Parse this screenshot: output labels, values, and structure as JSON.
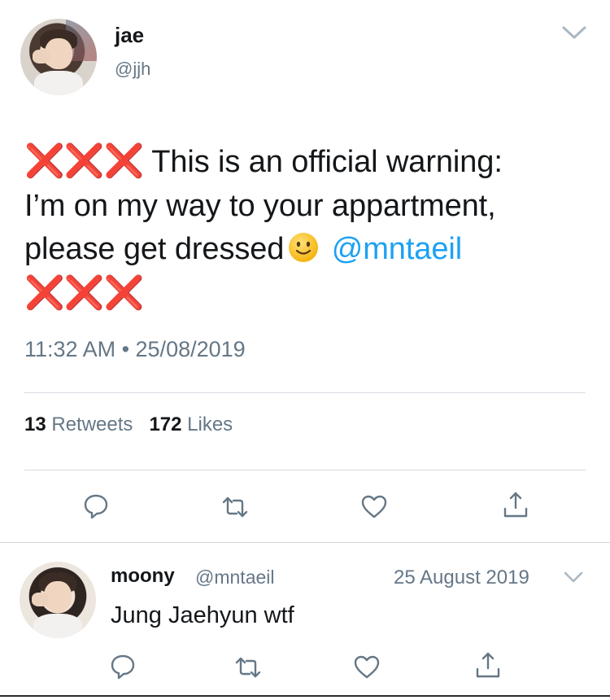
{
  "tweet": {
    "author": {
      "display_name": "jae",
      "handle": "@jjh"
    },
    "text": {
      "prefix_marks": "❌❌❌",
      "line_1": "This is an official warning:",
      "line_2": "I’m on my way to your appartment,",
      "line_3": "please get dressed",
      "mention": "@mntaeil",
      "suffix_marks": "❌❌❌"
    },
    "timestamp": "11:32 AM • 25/08/2019",
    "stats": {
      "retweets_count": "13",
      "retweets_label": "Retweets",
      "likes_count": "172",
      "likes_label": "Likes"
    },
    "actions": [
      "reply-icon",
      "retweet-icon",
      "like-icon",
      "share-icon"
    ]
  },
  "reply": {
    "author": {
      "display_name": "moony",
      "handle": "@mntaeil"
    },
    "date": "25 August 2019",
    "text": "Jung Jaehyun wtf",
    "actions": [
      "reply-icon",
      "retweet-icon",
      "like-icon",
      "share-icon"
    ]
  },
  "colors": {
    "text_primary": "#14171a",
    "text_secondary": "#657786",
    "link": "#1da1f2",
    "cross_mark": "#e0102a",
    "divider": "#d6dbe0"
  }
}
